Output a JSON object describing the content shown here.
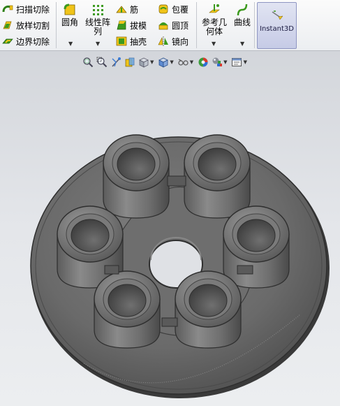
{
  "ribbon": {
    "features_col1": [
      "扫描切除",
      "放样切割",
      "边界切除"
    ],
    "fillet": "圆角",
    "linear_pattern_line1": "线性阵",
    "linear_pattern_line2": "列",
    "features_col3": [
      "筋",
      "拔模",
      "抽壳"
    ],
    "features_col4": [
      "包覆",
      "圆顶",
      "镜向"
    ],
    "reference_geometry_line1": "参考几",
    "reference_geometry_line2": "何体",
    "curves": "曲线",
    "instant3d": "Instant3D"
  },
  "heads_up_toolbar": {
    "icons": [
      "zoom-to-fit-icon",
      "zoom-area-icon",
      "previous-view-icon",
      "section-view-icon",
      "view-orientation-icon",
      "display-style-icon",
      "hide-show-items-icon",
      "edit-appearance-icon",
      "apply-scene-icon",
      "view-settings-icon"
    ]
  },
  "colors": {
    "ribbon_bg": "#f4f5f7",
    "viewport_bg": "#e1e3e7",
    "model_gray": "#5f5f5f",
    "instant3d_active": "#c9cde8",
    "icon_green": "#3c9a1e",
    "icon_yellow": "#f0c419"
  }
}
